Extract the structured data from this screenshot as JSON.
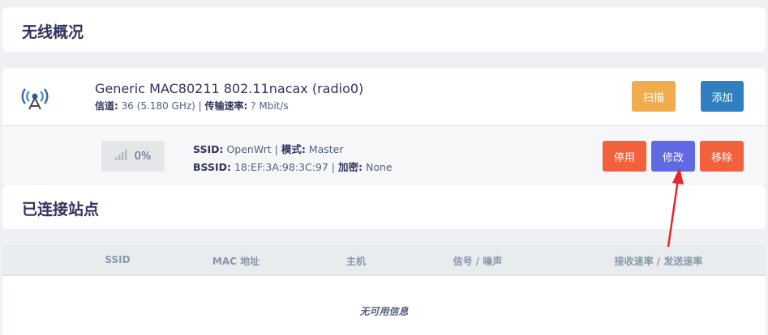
{
  "overview": {
    "title": "无线概况"
  },
  "radio": {
    "name": "Generic MAC80211 802.11nacax (radio0)",
    "channel_label": "信道:",
    "channel_value": " 36 (5.180 GHz) | ",
    "bitrate_label": "传输速率:",
    "bitrate_value": " ? Mbit/s",
    "icon": "wireless-antenna-icon",
    "scan_label": "扫描",
    "add_label": "添加"
  },
  "network": {
    "signal_icon": "signal-bars-icon",
    "signal_percent": "0%",
    "ssid_label": "SSID:",
    "ssid_value": " OpenWrt | ",
    "mode_label": "模式:",
    "mode_value": " Master",
    "bssid_label": "BSSID:",
    "bssid_value": " 18:EF:3A:98:3C:97 | ",
    "encryption_label": "加密:",
    "encryption_value": " None",
    "disable_label": "停用",
    "edit_label": "修改",
    "remove_label": "移除"
  },
  "stations": {
    "title": "已连接站点",
    "columns": [
      "SSID",
      "MAC 地址",
      "主机",
      "信号 / 噪声",
      "接收速率 / 发送速率"
    ],
    "empty_message": "无可用信息"
  },
  "colors": {
    "scan": "#f0ad4e",
    "add": "#2f7fc1",
    "disable": "#f3603c",
    "edit": "#6068e4",
    "remove": "#f3603c",
    "annotation_arrow": "#e8262b"
  }
}
